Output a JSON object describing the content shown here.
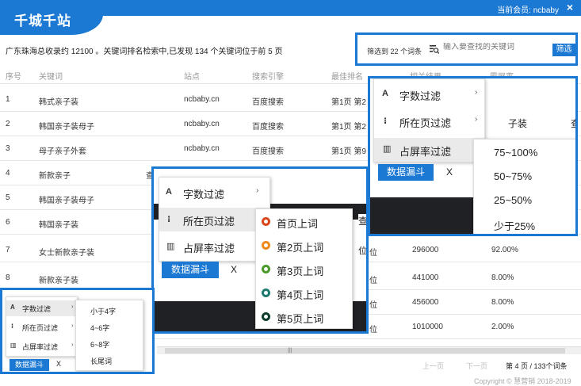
{
  "header": {
    "logo": "千城千站",
    "member_label": "当前会员: ncbaby",
    "close": "×"
  },
  "summary": "广东珠海总收录约 12100 。关键词排名检索中,已发现 134 个关键词位于前 5 页",
  "filterbar": {
    "count_label": "筛选到 22 个词条",
    "search_placeholder": "输入要查找的关键词",
    "button": "筛选"
  },
  "table": {
    "headers": [
      "序号",
      "关键词",
      "站点",
      "搜索引擎",
      "最佳排名",
      "相关结果",
      "霸屏率"
    ],
    "rows": [
      {
        "no": "1",
        "kw": "韩式亲子装",
        "site": "ncbaby.cn",
        "engine": "百度搜索",
        "rank": "第1页 第2",
        "result": "",
        "rate": ""
      },
      {
        "no": "2",
        "kw": "韩国亲子装母子",
        "site": "ncbaby.cn",
        "engine": "百度搜索",
        "rank": "第1页 第2",
        "result": "",
        "rate": ""
      },
      {
        "no": "3",
        "kw": "母子亲子外套",
        "site": "ncbaby.cn",
        "engine": "百度搜索",
        "rank": "第1页 第9",
        "result": "",
        "rate": ""
      },
      {
        "no": "4",
        "kw": "新款亲子",
        "site": "",
        "engine": "",
        "rank": "",
        "result": "",
        "rate": ""
      },
      {
        "no": "5",
        "kw": "韩国亲子装母子",
        "site": "",
        "engine": "",
        "rank": "",
        "result": "",
        "rate": ""
      },
      {
        "no": "6",
        "kw": "韩国亲子装",
        "site": "",
        "engine": "",
        "rank": "",
        "result": "",
        "rate": ""
      },
      {
        "no": "7",
        "kw": "女士新款亲子装",
        "site": "",
        "engine": "",
        "rank": "",
        "result": "296000",
        "rate": "92.00%"
      },
      {
        "no": "8",
        "kw": "新款亲子装",
        "site": "",
        "engine": "",
        "rank": "",
        "result": "441000",
        "rate": "8.00%"
      },
      {
        "no": "",
        "kw": "",
        "site": "",
        "engine": "",
        "rank": "",
        "result": "456000",
        "rate": "8.00%"
      },
      {
        "no": "",
        "kw": "",
        "site": "",
        "engine": "",
        "rank": "",
        "result": "1010000",
        "rate": "2.00%"
      }
    ],
    "frag_chars": [
      "查",
      "查",
      "位",
      "位",
      "位",
      "位",
      "位",
      "查"
    ]
  },
  "footer": {
    "prev": "上一页",
    "next": "下一页",
    "info": "第 4 页 / 133个词条",
    "copyright": "Copyright © 慧营销 2018-2019"
  },
  "menu": {
    "items": [
      "字数过滤",
      "所在页过滤",
      "占屏率过滤"
    ],
    "icons": [
      "A",
      "⁝",
      "▥"
    ],
    "leak_button": "数据漏斗",
    "leak_close": "X"
  },
  "panel_right": {
    "submenu": [
      "75~100%",
      "50~75%",
      "25~50%",
      "少于25%"
    ],
    "behind_text": "子装"
  },
  "panel_mid": {
    "submenu": [
      "首页上词",
      "第2页上词",
      "第3页上词",
      "第4页上词",
      "第5页上词"
    ],
    "dot_colors": [
      "#d9461a",
      "#f08a1c",
      "#4a9a2a",
      "#1f7a70",
      "#0f3d2a"
    ]
  },
  "panel_left": {
    "submenu": [
      "小于4字",
      "4~6字",
      "6~8字",
      "长尾词"
    ]
  },
  "colors": {
    "brand": "#1b78d3"
  }
}
